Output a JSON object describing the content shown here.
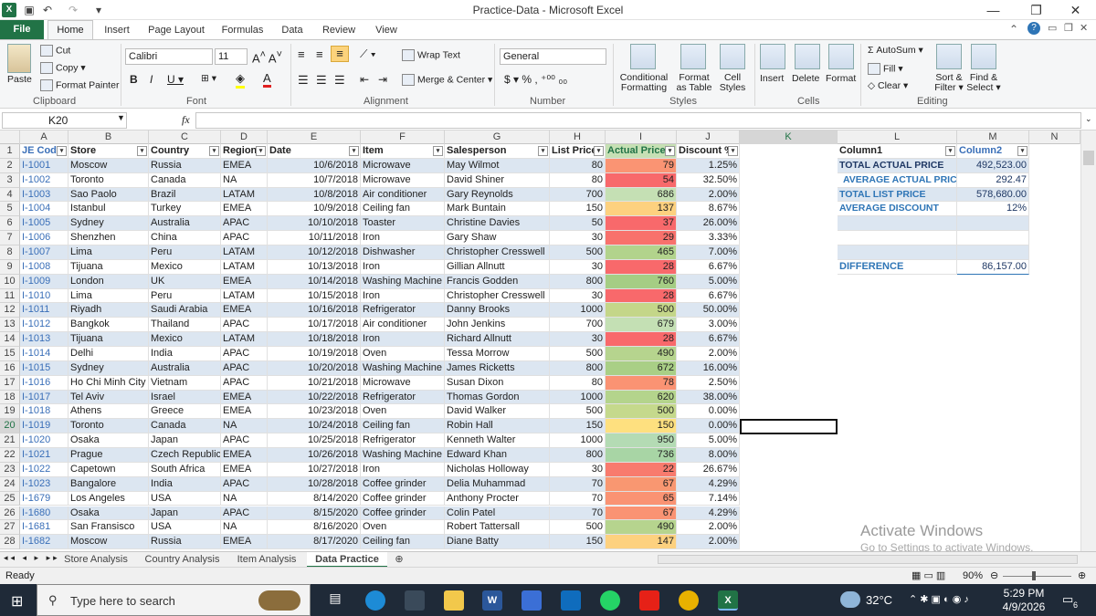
{
  "window": {
    "title": "Practice-Data  -  Microsoft Excel"
  },
  "tabs": [
    "File",
    "Home",
    "Insert",
    "Page Layout",
    "Formulas",
    "Data",
    "Review",
    "View"
  ],
  "ribbon": {
    "clipboard": {
      "label": "Clipboard",
      "paste": "Paste",
      "cut": "Cut",
      "copy": "Copy",
      "format_painter": "Format Painter"
    },
    "font": {
      "label": "Font",
      "name": "Calibri",
      "size": "11"
    },
    "alignment": {
      "label": "Alignment",
      "wrap": "Wrap Text",
      "merge": "Merge & Center"
    },
    "number": {
      "label": "Number",
      "format": "General"
    },
    "styles": {
      "label": "Styles",
      "cond": "Conditional",
      "cond2": "Formatting",
      "fmt": "Format",
      "fmt2": "as Table",
      "cell": "Cell",
      "cell2": "Styles"
    },
    "cells": {
      "label": "Cells",
      "insert": "Insert",
      "delete": "Delete",
      "format": "Format"
    },
    "editing": {
      "label": "Editing",
      "autosum": "AutoSum",
      "fill": "Fill",
      "clear": "Clear",
      "sort": "Sort &",
      "sort2": "Filter",
      "find": "Find &",
      "find2": "Select"
    }
  },
  "formula_bar": {
    "name_box": "K20",
    "fx": "fx",
    "content": ""
  },
  "columns": [
    "A",
    "B",
    "C",
    "D",
    "E",
    "F",
    "G",
    "H",
    "I",
    "J",
    "K",
    "L",
    "M",
    "N"
  ],
  "headers": [
    "JE Code",
    "Store",
    "Country",
    "Region",
    "Date",
    "Item",
    "Salesperson",
    "List Price",
    "Actual Price",
    "Discount %"
  ],
  "rows": [
    [
      "I-1001",
      "Moscow",
      "Russia",
      "EMEA",
      "10/6/2018",
      "Microwave",
      "May Wilmot",
      "80",
      "79",
      "1.25%"
    ],
    [
      "I-1002",
      "Toronto",
      "Canada",
      "NA",
      "10/7/2018",
      "Microwave",
      "David Shiner",
      "80",
      "54",
      "32.50%"
    ],
    [
      "I-1003",
      "Sao Paolo",
      "Brazil",
      "LATAM",
      "10/8/2018",
      "Air conditioner",
      "Gary Reynolds",
      "700",
      "686",
      "2.00%"
    ],
    [
      "I-1004",
      "Istanbul",
      "Turkey",
      "EMEA",
      "10/9/2018",
      "Ceiling fan",
      "Mark Buntain",
      "150",
      "137",
      "8.67%"
    ],
    [
      "I-1005",
      "Sydney",
      "Australia",
      "APAC",
      "10/10/2018",
      "Toaster",
      "Christine Davies",
      "50",
      "37",
      "26.00%"
    ],
    [
      "I-1006",
      "Shenzhen",
      "China",
      "APAC",
      "10/11/2018",
      "Iron",
      "Gary Shaw",
      "30",
      "29",
      "3.33%"
    ],
    [
      "I-1007",
      "Lima",
      "Peru",
      "LATAM",
      "10/12/2018",
      "Dishwasher",
      "Christopher Cresswell",
      "500",
      "465",
      "7.00%"
    ],
    [
      "I-1008",
      "Tijuana",
      "Mexico",
      "LATAM",
      "10/13/2018",
      "Iron",
      "Gillian Allnutt",
      "30",
      "28",
      "6.67%"
    ],
    [
      "I-1009",
      "London",
      "UK",
      "EMEA",
      "10/14/2018",
      "Washing Machine",
      "Francis Godden",
      "800",
      "760",
      "5.00%"
    ],
    [
      "I-1010",
      "Lima",
      "Peru",
      "LATAM",
      "10/15/2018",
      "Iron",
      "Christopher Cresswell",
      "30",
      "28",
      "6.67%"
    ],
    [
      "I-1011",
      "Riyadh",
      "Saudi Arabia",
      "EMEA",
      "10/16/2018",
      "Refrigerator",
      "Danny Brooks",
      "1000",
      "500",
      "50.00%"
    ],
    [
      "I-1012",
      "Bangkok",
      "Thailand",
      "APAC",
      "10/17/2018",
      "Air conditioner",
      "John Jenkins",
      "700",
      "679",
      "3.00%"
    ],
    [
      "I-1013",
      "Tijuana",
      "Mexico",
      "LATAM",
      "10/18/2018",
      "Iron",
      "Richard Allnutt",
      "30",
      "28",
      "6.67%"
    ],
    [
      "I-1014",
      "Delhi",
      "India",
      "APAC",
      "10/19/2018",
      "Oven",
      "Tessa Morrow",
      "500",
      "490",
      "2.00%"
    ],
    [
      "I-1015",
      "Sydney",
      "Australia",
      "APAC",
      "10/20/2018",
      "Washing Machine",
      "James Ricketts",
      "800",
      "672",
      "16.00%"
    ],
    [
      "I-1016",
      "Ho Chi Minh City",
      "Vietnam",
      "APAC",
      "10/21/2018",
      "Microwave",
      "Susan Dixon",
      "80",
      "78",
      "2.50%"
    ],
    [
      "I-1017",
      "Tel Aviv",
      "Israel",
      "EMEA",
      "10/22/2018",
      "Refrigerator",
      "Thomas Gordon",
      "1000",
      "620",
      "38.00%"
    ],
    [
      "I-1018",
      "Athens",
      "Greece",
      "EMEA",
      "10/23/2018",
      "Oven",
      "David Walker",
      "500",
      "500",
      "0.00%"
    ],
    [
      "I-1019",
      "Toronto",
      "Canada",
      "NA",
      "10/24/2018",
      "Ceiling fan",
      "Robin Hall",
      "150",
      "150",
      "0.00%"
    ],
    [
      "I-1020",
      "Osaka",
      "Japan",
      "APAC",
      "10/25/2018",
      "Refrigerator",
      "Kenneth Walter",
      "1000",
      "950",
      "5.00%"
    ],
    [
      "I-1021",
      "Prague",
      "Czech Republic",
      "EMEA",
      "10/26/2018",
      "Washing Machine",
      "Edward Khan",
      "800",
      "736",
      "8.00%"
    ],
    [
      "I-1022",
      "Capetown",
      "South Africa",
      "EMEA",
      "10/27/2018",
      "Iron",
      "Nicholas Holloway",
      "30",
      "22",
      "26.67%"
    ],
    [
      "I-1023",
      "Bangalore",
      "India",
      "APAC",
      "10/28/2018",
      "Coffee grinder",
      "Delia Muhammad",
      "70",
      "67",
      "4.29%"
    ],
    [
      "I-1679",
      "Los Angeles",
      "USA",
      "NA",
      "8/14/2020",
      "Coffee grinder",
      "Anthony Procter",
      "70",
      "65",
      "7.14%"
    ],
    [
      "I-1680",
      "Osaka",
      "Japan",
      "APAC",
      "8/15/2020",
      "Coffee grinder",
      "Colin Patel",
      "70",
      "67",
      "4.29%"
    ],
    [
      "I-1681",
      "San Fransisco",
      "USA",
      "NA",
      "8/16/2020",
      "Oven",
      "Robert Tattersall",
      "500",
      "490",
      "2.00%"
    ],
    [
      "I-1682",
      "Moscow",
      "Russia",
      "EMEA",
      "8/17/2020",
      "Ceiling fan",
      "Diane Batty",
      "150",
      "147",
      "2.00%"
    ]
  ],
  "actual_colors": [
    "#fa9473",
    "#f8696b",
    "#c5e0b4",
    "#fdd17f",
    "#f8696b",
    "#f8716c",
    "#b2d38c",
    "#f8696b",
    "#a5cd84",
    "#f8696b",
    "#c4d689",
    "#c4e0b4",
    "#f8696b",
    "#b6d48e",
    "#a9cf86",
    "#fa9373",
    "#b4d48c",
    "#c5d98c",
    "#fee07f",
    "#b4dbb4",
    "#a8d5a5",
    "#f87b6e",
    "#f99771",
    "#fa9373",
    "#fa9373",
    "#b6d48e",
    "#fdd17f"
  ],
  "summary": {
    "col1_header": "Column1",
    "col2_header": "Column2",
    "items": [
      {
        "label": "TOTAL ACTUAL PRICE",
        "value": "492,523.00"
      },
      {
        "label": "AVERAGE ACTUAL PRICE",
        "value": "292.47"
      },
      {
        "label": "TOTAL LIST PRICE",
        "value": "578,680.00"
      },
      {
        "label": "AVERAGE DISCOUNT",
        "value": "12%"
      }
    ],
    "difference_label": "DIFFERENCE",
    "difference_value": "86,157.00"
  },
  "row_numbers": [
    "1",
    "2",
    "3",
    "4",
    "5",
    "6",
    "7",
    "8",
    "9",
    "10",
    "11",
    "12",
    "13",
    "14",
    "15",
    "16",
    "17",
    "18",
    "19",
    "20",
    "21",
    "22",
    "23",
    "24",
    "25",
    "26",
    "27",
    "28"
  ],
  "sheets": [
    "Store Analysis",
    "Country Analysis",
    "Item Analysis",
    "Data Practice"
  ],
  "active_sheet": "Data Practice",
  "status": {
    "text": "Ready",
    "zoom": "90%"
  },
  "watermark": {
    "line1": "Activate Windows",
    "line2": "Go to Settings to activate Windows."
  },
  "taskbar": {
    "search": "Type here to search",
    "temp": "32°C",
    "time": "5:29 PM",
    "date": "4/9/2026",
    "badge": "6"
  }
}
